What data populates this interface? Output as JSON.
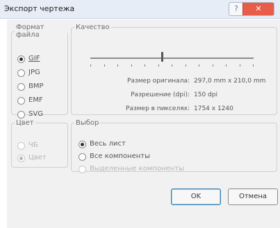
{
  "window": {
    "title": "Экспорт чертежа",
    "help_glyph": "?",
    "close_glyph": "✕"
  },
  "file_format": {
    "legend": "Формат файла",
    "options": [
      {
        "label": "GIF",
        "selected": true
      },
      {
        "label": "JPG",
        "selected": false
      },
      {
        "label": "BMP",
        "selected": false
      },
      {
        "label": "EMF",
        "selected": false
      },
      {
        "label": "SVG",
        "selected": false
      }
    ]
  },
  "quality": {
    "legend": "Качество",
    "slider_value": 0.44,
    "info": [
      {
        "label": "Размер оригинала:",
        "value": "297,0 mm x 210,0 mm"
      },
      {
        "label": "Разрешение (dpi):",
        "value": "150 dpi"
      },
      {
        "label": "Размер в пикселях:",
        "value": "1754 x 1240"
      }
    ]
  },
  "color": {
    "legend": "Цвет",
    "options": [
      {
        "label": "ЧБ",
        "selected": false
      },
      {
        "label": "Цвет",
        "selected": true
      }
    ]
  },
  "selection": {
    "legend": "Выбор",
    "options": [
      {
        "label": "Весь лист",
        "selected": true,
        "disabled": false
      },
      {
        "label": "Все компоненты",
        "selected": false,
        "disabled": false
      },
      {
        "label": "Выделенные компоненты",
        "selected": false,
        "disabled": true
      }
    ]
  },
  "buttons": {
    "ok": "OK",
    "cancel": "Отмена"
  }
}
